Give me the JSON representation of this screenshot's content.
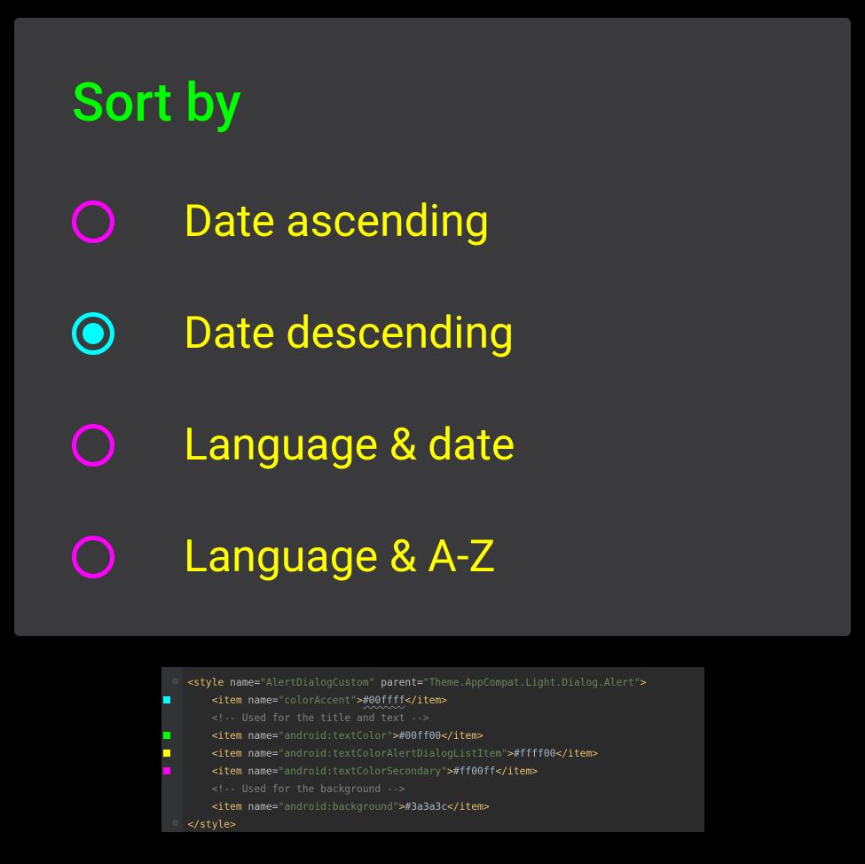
{
  "dialog": {
    "title": "Sort by",
    "options": [
      {
        "label": "Date ascending",
        "selected": false
      },
      {
        "label": "Date descending",
        "selected": true
      },
      {
        "label": "Language & date",
        "selected": false
      },
      {
        "label": "Language & A-Z",
        "selected": false
      }
    ]
  },
  "code": {
    "style_name": "AlertDialogCustom",
    "parent": "Theme.AppCompat.Light.Dialog.Alert",
    "items": [
      {
        "name": "colorAccent",
        "value": "#00ffff",
        "comment_before": null,
        "wavy": true
      },
      {
        "name": "android:textColor",
        "value": "#00ff00",
        "comment_before": "Used for the title and text"
      },
      {
        "name": "android:textColorAlertDialogListItem",
        "value": "#ffff00",
        "comment_before": null
      },
      {
        "name": "android:textColorSecondary",
        "value": "#ff00ff",
        "comment_before": null
      },
      {
        "name": "android:background",
        "value": "#3a3a3c",
        "comment_before": "Used for the background"
      }
    ],
    "gutter_marks": [
      {
        "line": 1,
        "color": "#00ffff"
      },
      {
        "line": 3,
        "color": "#00ff00"
      },
      {
        "line": 4,
        "color": "#ffff00"
      },
      {
        "line": 5,
        "color": "#ff00ff"
      }
    ]
  }
}
